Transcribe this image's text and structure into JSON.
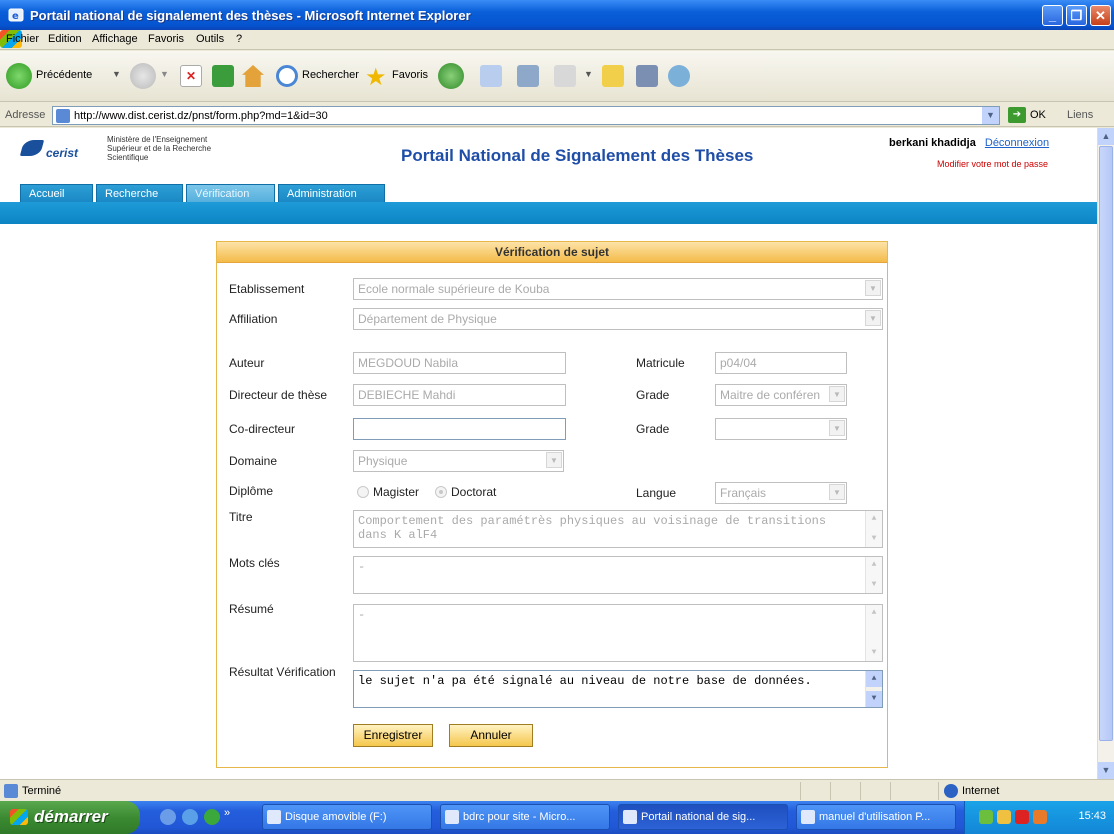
{
  "window": {
    "title": "Portail national de signalement des thèses - Microsoft Internet Explorer"
  },
  "menu": [
    "Fichier",
    "Edition",
    "Affichage",
    "Favoris",
    "Outils",
    "?"
  ],
  "toolbar": {
    "back": "Précédente",
    "search": "Rechercher",
    "favorites": "Favoris"
  },
  "address": {
    "label": "Adresse",
    "url": "http://www.dist.cerist.dz/pnst/form.php?md=1&id=30",
    "go": "OK",
    "links": "Liens"
  },
  "header": {
    "logo": "cerist",
    "ministry": [
      "Ministère de l'Enseignement",
      "Supérieur et de la Recherche",
      "Scientifique"
    ],
    "title": "Portail National de Signalement des Thèses",
    "user": "berkani khadidja",
    "logout": "Déconnexion",
    "change_password": "Modifier votre mot de passe"
  },
  "nav": {
    "tabs": [
      "Accueil",
      "Recherche",
      "Vérification",
      "Administration"
    ],
    "active": "Vérification"
  },
  "form": {
    "heading": "Vérification de sujet",
    "etablissement": {
      "label": "Etablissement",
      "value": "Ecole normale supérieure de Kouba"
    },
    "affiliation": {
      "label": "Affiliation",
      "value": "Département de Physique"
    },
    "auteur": {
      "label": "Auteur",
      "value": "MEGDOUD Nabila"
    },
    "matricule": {
      "label": "Matricule",
      "value": "p04/04"
    },
    "directeur": {
      "label": "Directeur de thèse",
      "value": "DEBIECHE Mahdi"
    },
    "grade1": {
      "label": "Grade",
      "value": "Maitre de conféren"
    },
    "codirecteur": {
      "label": "Co-directeur",
      "value": ""
    },
    "grade2": {
      "label": "Grade",
      "value": ""
    },
    "domaine": {
      "label": "Domaine",
      "value": "Physique"
    },
    "diplome": {
      "label": "Diplôme",
      "options": [
        "Magister",
        "Doctorat"
      ],
      "selected": "Doctorat"
    },
    "langue": {
      "label": "Langue",
      "value": "Français"
    },
    "titre": {
      "label": "Titre",
      "value": "Comportement des paramétrès physiques au voisinage de transitions dans K alF4"
    },
    "mots_cles": {
      "label": "Mots clés",
      "value": "-"
    },
    "resume": {
      "label": "Résumé",
      "value": "-"
    },
    "resultat": {
      "label": "Résultat Vérification",
      "value": "le sujet n'a pa été signalé au niveau de notre base de données."
    },
    "save": "Enregistrer",
    "cancel": "Annuler"
  },
  "status": {
    "text": "Terminé",
    "zone": "Internet"
  },
  "taskbar": {
    "start": "démarrer",
    "tasks": [
      "Disque amovible (F:)",
      "bdrc pour site - Micro...",
      "Portail national de sig...",
      "manuel d'utilisation P..."
    ],
    "clock": "15:43"
  }
}
